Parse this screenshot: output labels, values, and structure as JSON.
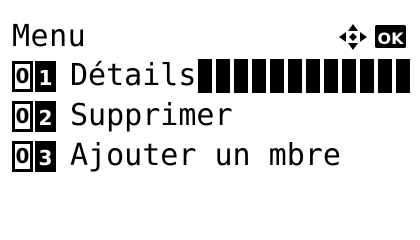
{
  "header": {
    "title": "Menu",
    "nav_icon": "four-way-arrow-icon",
    "ok_label": "OK"
  },
  "menu": {
    "items": [
      {
        "num_1": "0",
        "num_2": "1",
        "label": "Détails",
        "selected": true
      },
      {
        "num_1": "0",
        "num_2": "2",
        "label": "Supprimer",
        "selected": false
      },
      {
        "num_1": "0",
        "num_2": "3",
        "label": "Ajouter un mbre",
        "selected": false
      }
    ]
  },
  "colors": {
    "foreground": "#000000",
    "background": "#ffffff"
  }
}
